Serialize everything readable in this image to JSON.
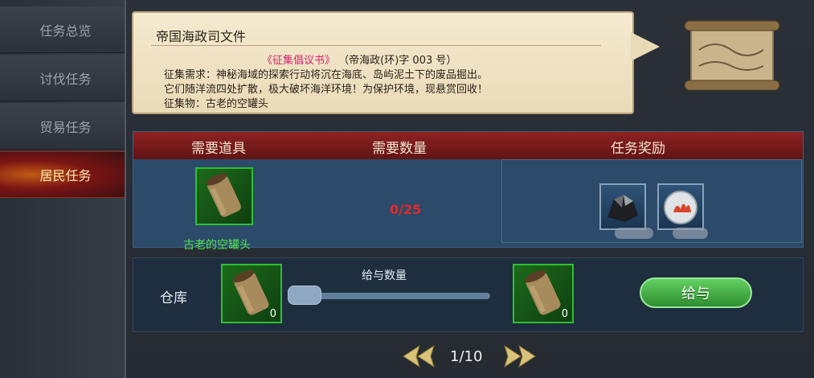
{
  "sidebar": {
    "items": [
      {
        "label": "任务总览",
        "active": false
      },
      {
        "label": "讨伐任务",
        "active": false
      },
      {
        "label": "贸易任务",
        "active": false
      },
      {
        "label": "居民任务",
        "active": true
      }
    ]
  },
  "notice": {
    "title": "帝国海政司文件",
    "book_name": "《征集倡议书》",
    "doc_number": "（帝海政(环)字 003 号）",
    "lines": [
      "征集需求：神秘海域的探索行动将沉在海底、岛屿泥土下的废品掘出。",
      "它们随洋流四处扩散，极大破坏海洋环境！为保护环境，现悬赏回收！",
      "征集物：古老的空罐头"
    ]
  },
  "requirements": {
    "headers": {
      "item": "需要道具",
      "quantity": "需要数量",
      "reward": "任务奖励"
    },
    "item": {
      "name": "古老的空罐头",
      "icon": "rusty-can-icon"
    },
    "count": "0/25",
    "rewards": [
      {
        "icon": "coal-ore-icon"
      },
      {
        "icon": "coral-dish-icon"
      }
    ]
  },
  "give": {
    "warehouse_label": "仓库",
    "amount_label": "给与数量",
    "warehouse_qty": "0",
    "give_qty": "0",
    "slider_value": 0,
    "button_label": "给与"
  },
  "pager": {
    "text": "1/10"
  },
  "colors": {
    "accent_red": "#7a1414",
    "count_red": "#e22a2a",
    "item_green": "#52e34a",
    "button_green": "#4cb24c"
  }
}
